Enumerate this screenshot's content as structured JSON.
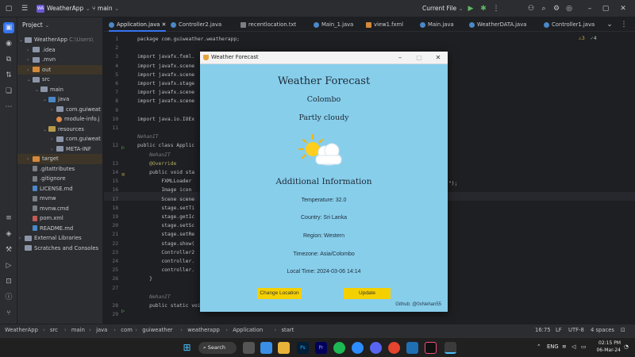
{
  "titlebar": {
    "app_badge": "WA",
    "project_name": "WeatherApp",
    "branch": "main",
    "run_config": "Current File"
  },
  "project_panel": {
    "title": "Project",
    "root_name": "WeatherApp",
    "root_path": "C:\\Users\\",
    "items": [
      {
        "label": ".idea",
        "kind": "folder"
      },
      {
        "label": ".mvn",
        "kind": "folder"
      },
      {
        "label": "out",
        "kind": "folder-excluded"
      },
      {
        "label": "src",
        "kind": "folder"
      },
      {
        "label": "main",
        "kind": "folder"
      },
      {
        "label": "java",
        "kind": "source-folder"
      },
      {
        "label": "com.guiweat",
        "kind": "package"
      },
      {
        "label": "module-info.j",
        "kind": "file"
      },
      {
        "label": "resources",
        "kind": "resource-folder"
      },
      {
        "label": "com.guiweat",
        "kind": "package"
      },
      {
        "label": "META-INF",
        "kind": "folder"
      },
      {
        "label": "target",
        "kind": "folder-excluded"
      },
      {
        "label": ".gitattributes",
        "kind": "file"
      },
      {
        "label": ".gitignore",
        "kind": "file"
      },
      {
        "label": "LICENSE.md",
        "kind": "file"
      },
      {
        "label": "mvnw",
        "kind": "file"
      },
      {
        "label": "mvnw.cmd",
        "kind": "file"
      },
      {
        "label": "pom.xml",
        "kind": "file"
      },
      {
        "label": "README.md",
        "kind": "file"
      },
      {
        "label": "External Libraries",
        "kind": "library"
      },
      {
        "label": "Scratches and Consoles",
        "kind": "scratch"
      }
    ]
  },
  "tabs": [
    {
      "label": "Application.java",
      "active": true
    },
    {
      "label": "Controller2.java"
    },
    {
      "label": "recentlocation.txt"
    },
    {
      "label": "Main_1.java"
    },
    {
      "label": "view1.fxml"
    },
    {
      "label": "Main.java"
    },
    {
      "label": "WeatherDATA.java"
    },
    {
      "label": "Controller1.java"
    }
  ],
  "inspection": {
    "warnings": "3",
    "checks": "4"
  },
  "editor": {
    "line_numbers": [
      "1",
      "2",
      "3",
      "4",
      "5",
      "6",
      "7",
      "8",
      "9",
      "10",
      "11",
      "",
      "12",
      "",
      "13",
      "14",
      "15",
      "16",
      "17",
      "18",
      "19",
      "20",
      "21",
      "22",
      "23",
      "24",
      "25",
      "26",
      "27",
      "",
      "28",
      "29"
    ],
    "lines": [
      "package com.guiweather.weatherapp;",
      "",
      "import javafx.fxml.",
      "import javafx.scene",
      "import javafx.scene",
      "import javafx.stage",
      "import javafx.scene",
      "import javafx.scene",
      "",
      "import java.io.IOEx",
      "",
      "NehanIT",
      "public class Applic",
      "    NehanIT",
      "    @Override",
      "    public void sta",
      "        FXMLLoader",
      "        Image icon",
      "        Scene scene",
      "        stage.setTi",
      "        stage.getIc",
      "        stage.setSc",
      "        stage.setRe",
      "        stage.show(",
      "        Controller2",
      "        controller.",
      "        controller.",
      "    }",
      "",
      "    NehanIT",
      "    public static void main(String[] args) {",
      ""
    ],
    "right_fragment": "\");"
  },
  "statusbar": {
    "breadcrumbs": [
      "WeatherApp",
      "src",
      "main",
      "java",
      "com",
      "guiweather",
      "weatherapp",
      "Application",
      "start"
    ],
    "position": "16:75",
    "line_ending": "LF",
    "encoding": "UTF-8",
    "indent": "4 spaces"
  },
  "taskbar": {
    "search_label": "Search",
    "time": "02:15 PM",
    "date": "06-Mar-24",
    "lang": "ENG"
  },
  "weather_window": {
    "title": "Weather Forecast",
    "heading": "Weather Forecast",
    "city": "Colombo",
    "condition": "Partly cloudy",
    "section_title": "Additional Information",
    "temperature": "Temperature: 32.0",
    "country": "Country: Sri Lanka",
    "region": "Region: Western",
    "timezone": "Timezone: Asia/Colombo",
    "local_time": "Local Time: 2024-03-06 14:14",
    "change_location_label": "Change Location",
    "update_label": "Update",
    "credit": "Github: @0xNehan55"
  },
  "colors": {
    "ide_bg": "#1e1f22",
    "panel_bg": "#2b2d30",
    "accent": "#3574f0",
    "weather_bg": "#87ceeb",
    "button_yellow": "#f5d000"
  }
}
